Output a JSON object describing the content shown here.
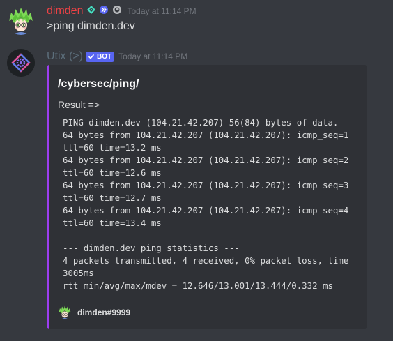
{
  "messages": [
    {
      "author": "dimden",
      "author_color": "#ed4245",
      "timestamp": "Today at 11:14 PM",
      "content": ">ping dimden.dev",
      "badges": [
        "hypesquad-icon",
        "nitro-icon",
        "booster-icon"
      ]
    },
    {
      "author": "Utix (>)",
      "author_color": "#5c6e7b",
      "bot_tag": "BOT",
      "timestamp": "Today at 11:14 PM",
      "embed": {
        "accent_color": "#9c3ef0",
        "title": "/cybersec/ping/",
        "description": "Result =>",
        "code_lines": [
          "PING dimden.dev (104.21.42.207) 56(84) bytes of data.",
          "64 bytes from 104.21.42.207 (104.21.42.207): icmp_seq=1",
          "ttl=60 time=13.2 ms",
          "64 bytes from 104.21.42.207 (104.21.42.207): icmp_seq=2",
          "ttl=60 time=12.6 ms",
          "64 bytes from 104.21.42.207 (104.21.42.207): icmp_seq=3",
          "ttl=60 time=12.7 ms",
          "64 bytes from 104.21.42.207 (104.21.42.207): icmp_seq=4",
          "ttl=60 time=13.4 ms",
          "",
          "--- dimden.dev ping statistics ---",
          "4 packets transmitted, 4 received, 0% packet loss, time",
          "3005ms",
          "rtt min/avg/max/mdev = 12.646/13.001/13.444/0.332 ms"
        ],
        "footer": "dimden#9999"
      }
    }
  ]
}
